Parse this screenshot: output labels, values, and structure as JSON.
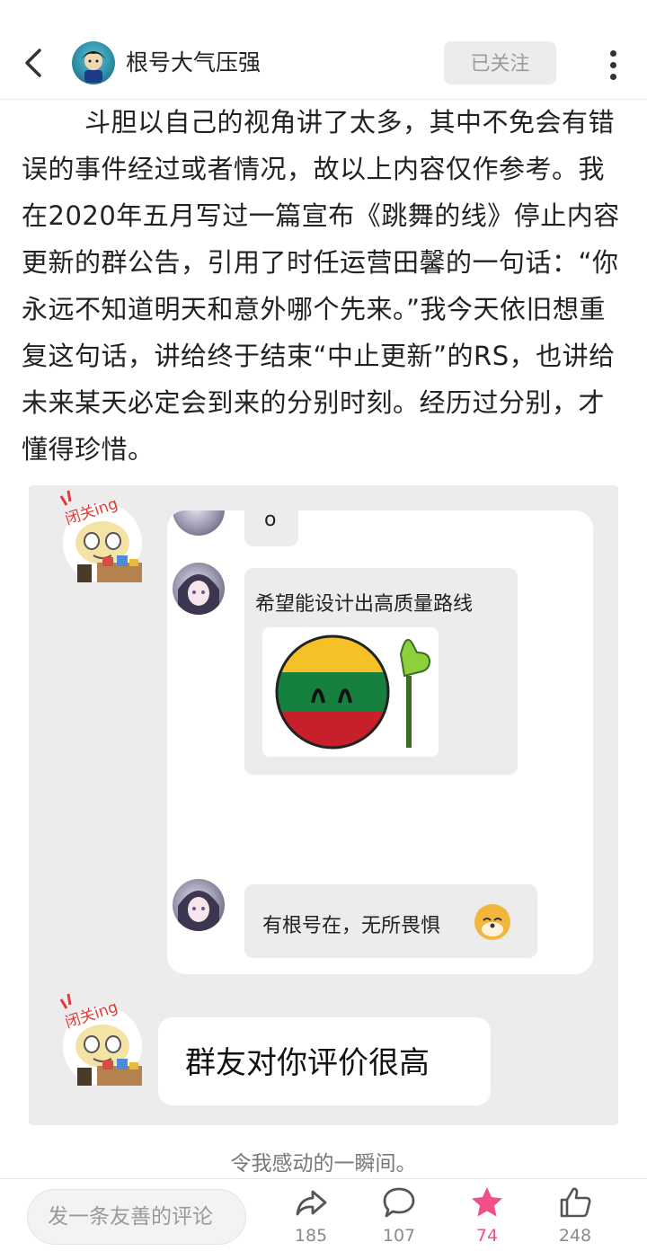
{
  "header": {
    "user_name": "根号大气压强",
    "follow_label": "已关注"
  },
  "article": {
    "paragraph": "斗胆以自己的视角讲了太多，其中不免会有错误的事件经过或者情况，故以上内容仅作参考。我在2020年五月写过一篇宣布《跳舞的线》停止内容更新的群公告，引用了时任运营田馨的一句话：“你永远不知道明天和意外哪个先来。”我今天依旧想重复这句话，讲给终于结束“中止更新”的RS，也讲给未来某天必定会到来的分别时刻。经历过分别，才懂得珍惜。"
  },
  "image": {
    "sticker_text": "闭关ing",
    "chat_top_text": "o",
    "chat_msg1": "希望能设计出高质量路线",
    "chat_msg2": "有根号在，无所畏惧",
    "big_msg": "群友对你评价很高"
  },
  "caption": "令我感动的一瞬间。",
  "bottom": {
    "comment_placeholder": "发一条友善的评论",
    "share_count": "185",
    "comment_count": "107",
    "star_count": "74",
    "like_count": "248"
  },
  "colors": {
    "accent": "#f04f8a",
    "follow_bg": "#ececec"
  },
  "icons": [
    "back-arrow-icon",
    "more-vertical-icon",
    "share-icon",
    "comment-icon",
    "star-icon",
    "thumbs-up-icon"
  ]
}
